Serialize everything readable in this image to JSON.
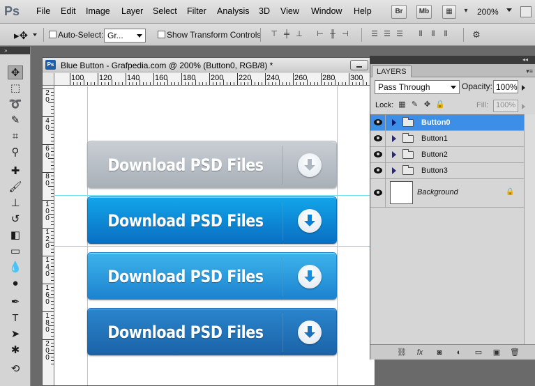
{
  "app": {
    "logo": "Ps"
  },
  "menu": [
    "File",
    "Edit",
    "Image",
    "Layer",
    "Select",
    "Filter",
    "Analysis",
    "3D",
    "View",
    "Window",
    "Help"
  ],
  "menubar_buttons": {
    "bridge": "Br",
    "mini_bridge": "Mb"
  },
  "zoom": "200%",
  "options_bar": {
    "auto_select_label": "Auto-Select:",
    "auto_select_value": "Gr...",
    "show_transform_label": "Show Transform Controls"
  },
  "document": {
    "title": "Blue Button - Grafpedia.com @ 200% (Button0, RGB/8) *",
    "hruler_labels": [
      "100",
      "120",
      "140",
      "160",
      "180",
      "200",
      "220",
      "240",
      "260",
      "280",
      "300"
    ],
    "vruler_labels": [
      "2 0",
      "4 0",
      "6 0",
      "8 0",
      "1 0 0",
      "1 2 0",
      "1 4 0",
      "1 6 0",
      "1 8 0",
      "2 0 0"
    ]
  },
  "buttons": [
    {
      "label": "Download PSD Files",
      "state": "disabled",
      "top_color": "#c9ced4",
      "bottom_color": "#a9b0b8",
      "arrow_color": "#aeb7c0"
    },
    {
      "label": "Download PSD Files",
      "state": "normal",
      "top_color": "#12a5ea",
      "bottom_color": "#0a6fc2",
      "arrow_color": "#0a7fd4"
    },
    {
      "label": "Download PSD Files",
      "state": "hover",
      "top_color": "#3cb4ec",
      "bottom_color": "#1d83cf",
      "arrow_color": "#1a8fd9"
    },
    {
      "label": "Download PSD Files",
      "state": "active",
      "top_color": "#2a85cc",
      "bottom_color": "#1b63a8",
      "arrow_color": "#1c6fb8"
    }
  ],
  "layers_panel": {
    "tab": "LAYERS",
    "blend_mode": "Pass Through",
    "opacity_label": "Opacity:",
    "opacity_value": "100%",
    "lock_label": "Lock:",
    "fill_label": "Fill:",
    "fill_value": "100%",
    "layers": [
      {
        "name": "Button0",
        "type": "group",
        "selected": true
      },
      {
        "name": "Button1",
        "type": "group",
        "selected": false
      },
      {
        "name": "Button2",
        "type": "group",
        "selected": false
      },
      {
        "name": "Button3",
        "type": "group",
        "selected": false
      }
    ],
    "background_layer": "Background",
    "selection_color": "#3d8ee6"
  }
}
